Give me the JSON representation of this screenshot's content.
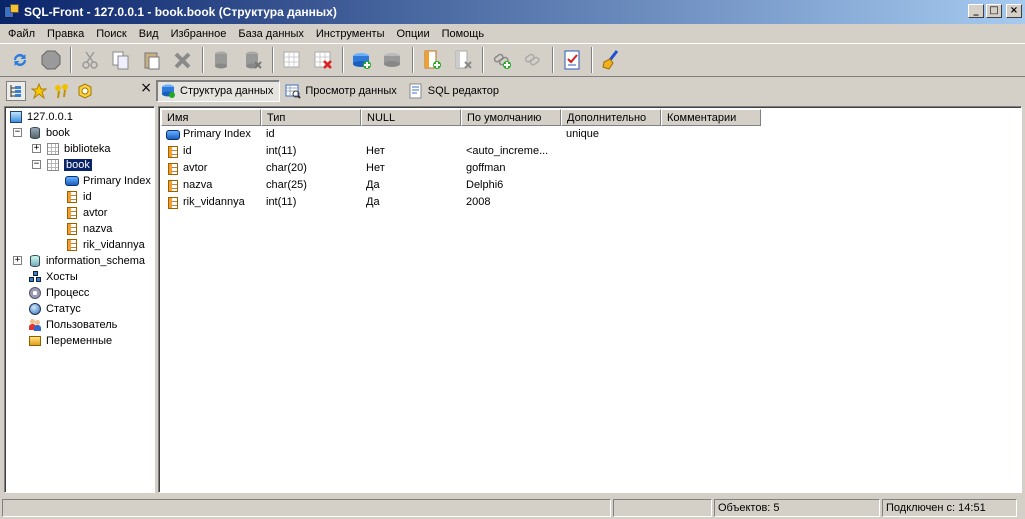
{
  "window": {
    "title": "SQL-Front - 127.0.0.1 - book.book  (Структура данных)",
    "controls": [
      "_",
      "□",
      "×"
    ]
  },
  "menu": [
    "Файл",
    "Правка",
    "Поиск",
    "Вид",
    "Избранное",
    "База данных",
    "Инструменты",
    "Опции",
    "Помощь"
  ],
  "toolbar": {
    "buttons": [
      "refresh-icon",
      "stop-icon",
      "cut-icon",
      "copy-icon",
      "paste-icon",
      "delete-icon",
      "new-database-icon",
      "delete-database-icon",
      "new-table-icon",
      "delete-table-icon",
      "new-server-icon",
      "delete-server-icon",
      "new-field-icon",
      "delete-field-icon",
      "new-link-icon",
      "delete-link-icon",
      "checklist-icon",
      "broom-icon"
    ]
  },
  "sidebar_tools": {
    "close": "×"
  },
  "tabs": [
    {
      "label": "Структура данных",
      "active": true
    },
    {
      "label": "Просмотр данных",
      "active": false
    },
    {
      "label": "SQL редактор",
      "active": false
    }
  ],
  "tree": {
    "server": "127.0.0.1",
    "db_book": "book",
    "tbl_biblioteka": "biblioteka",
    "tbl_book": "book",
    "idx_primary": "Primary Index",
    "f_id": "id",
    "f_avtor": "avtor",
    "f_nazva": "nazva",
    "f_rik": "rik_vidannya",
    "db_info": "information_schema",
    "hosts": "Хосты",
    "process": "Процесс",
    "status": "Статус",
    "users": "Пользователь",
    "vars": "Переменные",
    "expand_plus": "+",
    "expand_minus": "−"
  },
  "grid": {
    "headers": [
      "Имя",
      "Тип",
      "NULL",
      "По умолчанию",
      "Дополнительно",
      "Комментарии"
    ],
    "rows": [
      [
        "Primary Index",
        "id",
        "",
        "",
        "unique",
        ""
      ],
      [
        "id",
        "int(11)",
        "Нет",
        "<auto_increme...",
        "",
        ""
      ],
      [
        "avtor",
        "char(20)",
        "Нет",
        "goffman",
        "",
        ""
      ],
      [
        "nazva",
        "char(25)",
        "Да",
        "Delphi6",
        "",
        ""
      ],
      [
        "rik_vidannya",
        "int(11)",
        "Да",
        "2008",
        "",
        ""
      ]
    ]
  },
  "statusbar": {
    "objects": "Объектов: 5",
    "connected": "Подключен с: 14:51"
  }
}
